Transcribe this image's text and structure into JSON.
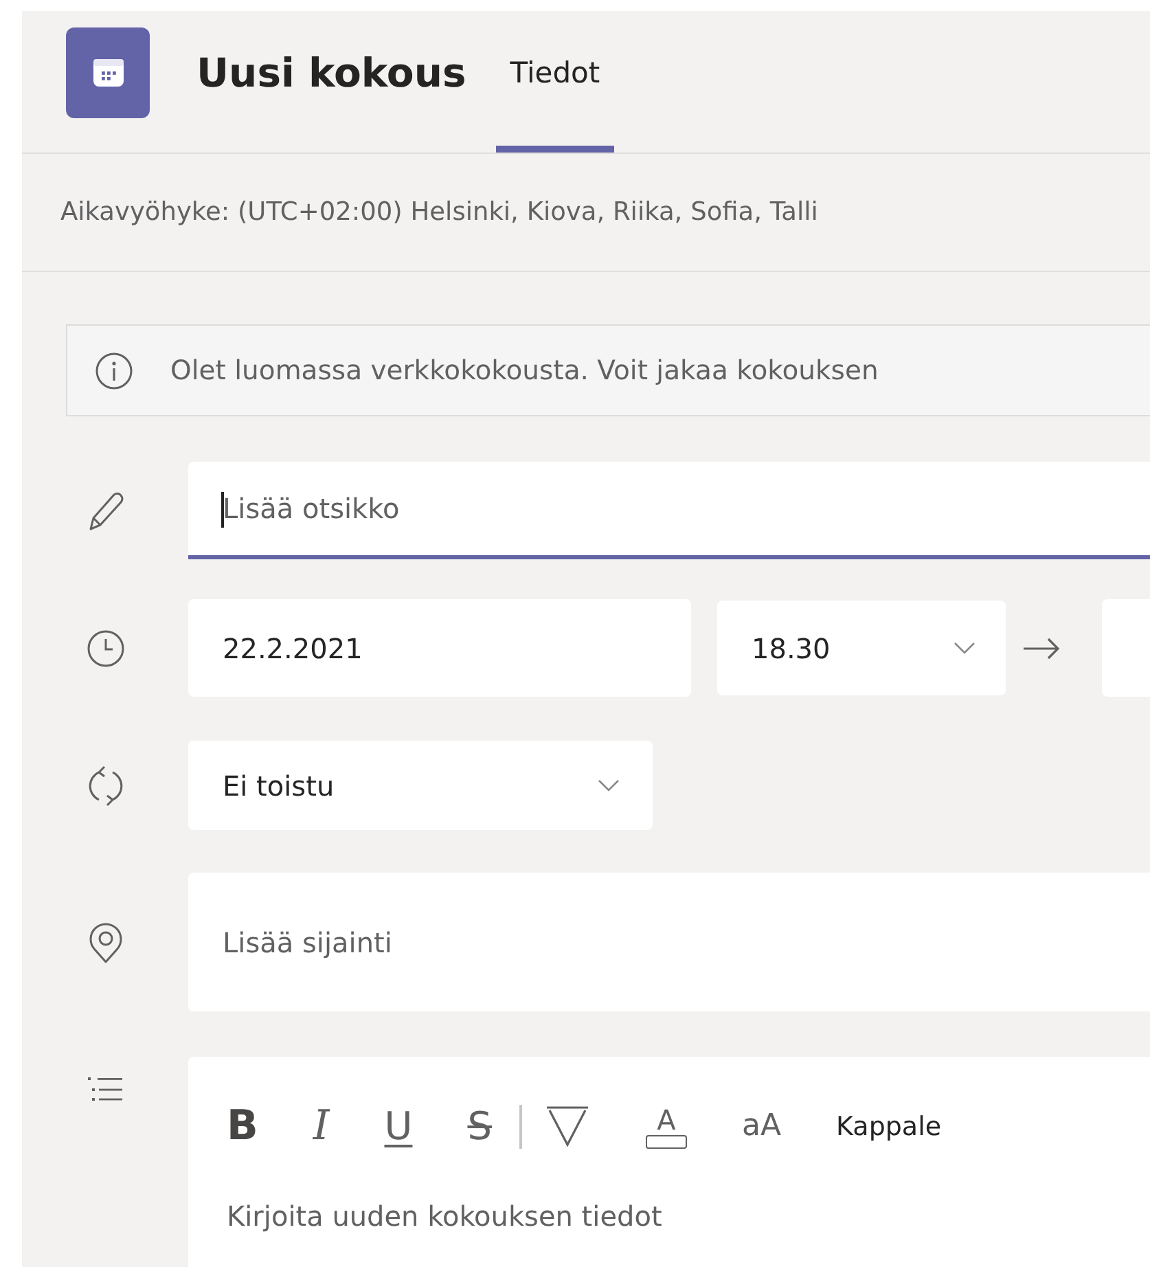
{
  "header": {
    "title": "Uusi kokous",
    "tabs": [
      {
        "label": "Tiedot",
        "selected": true
      }
    ]
  },
  "timezone": "Aikavyöhyke: (UTC+02:00) Helsinki, Kiova, Riika, Sofia, Talli",
  "info_banner": "Olet luomassa verkkokokousta. Voit jakaa kokouksen",
  "title_field": {
    "placeholder": "Lisää otsikko",
    "focused": true
  },
  "schedule": {
    "start_date": "22.2.2021",
    "start_time": "18.30"
  },
  "repeat": "Ei toistu",
  "location": {
    "placeholder": "Lisää sijainti"
  },
  "editor": {
    "toolbar": [
      {
        "kind": "bold",
        "label": "B"
      },
      {
        "kind": "italic",
        "label": "I"
      },
      {
        "kind": "underline",
        "label": "U"
      },
      {
        "kind": "strike",
        "label": "S"
      },
      {
        "kind": "separator"
      },
      {
        "kind": "highlight"
      },
      {
        "kind": "font-color",
        "label": "A"
      },
      {
        "kind": "font-size",
        "label": "aA"
      },
      {
        "kind": "paragraph",
        "label": "Kappale"
      }
    ],
    "placeholder": "Kirjoita uuden kokouksen tiedot"
  }
}
